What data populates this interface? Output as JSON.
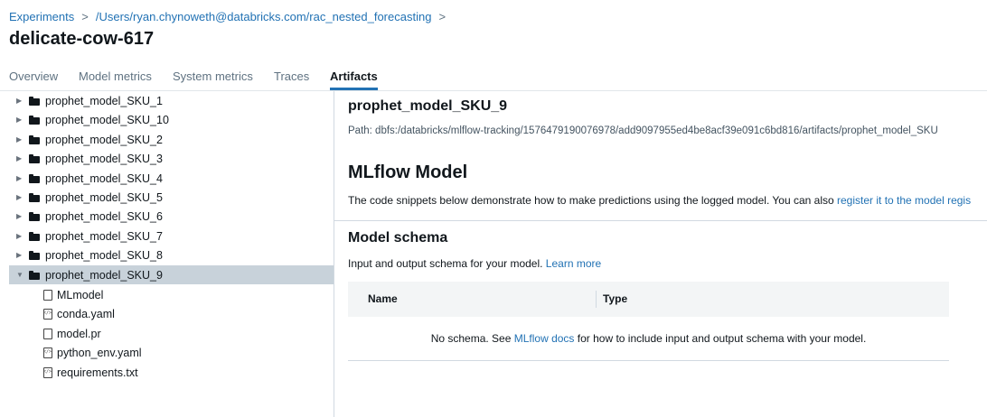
{
  "breadcrumb": {
    "items": [
      "Experiments",
      "/Users/ryan.chynoweth@databricks.com/rac_nested_forecasting"
    ],
    "separator": ">"
  },
  "run": {
    "title": "delicate-cow-617"
  },
  "tabs": [
    {
      "label": "Overview",
      "active": false
    },
    {
      "label": "Model metrics",
      "active": false
    },
    {
      "label": "System metrics",
      "active": false
    },
    {
      "label": "Traces",
      "active": false
    },
    {
      "label": "Artifacts",
      "active": true
    }
  ],
  "tree": {
    "folders": [
      {
        "label": "prophet_model_SKU_1",
        "expanded": false
      },
      {
        "label": "prophet_model_SKU_10",
        "expanded": false
      },
      {
        "label": "prophet_model_SKU_2",
        "expanded": false
      },
      {
        "label": "prophet_model_SKU_3",
        "expanded": false
      },
      {
        "label": "prophet_model_SKU_4",
        "expanded": false
      },
      {
        "label": "prophet_model_SKU_5",
        "expanded": false
      },
      {
        "label": "prophet_model_SKU_6",
        "expanded": false
      },
      {
        "label": "prophet_model_SKU_7",
        "expanded": false
      },
      {
        "label": "prophet_model_SKU_8",
        "expanded": false
      },
      {
        "label": "prophet_model_SKU_9",
        "expanded": true
      }
    ],
    "files": [
      "MLmodel",
      "conda.yaml",
      "model.pr",
      "python_env.yaml",
      "requirements.txt"
    ],
    "caret_collapsed": "▶",
    "caret_expanded": "▼"
  },
  "detail": {
    "artifact_title": "prophet_model_SKU_9",
    "path": "Path: dbfs:/databricks/mlflow-tracking/1576479190076978/add9097955ed4be8acf39e091c6bd816/artifacts/prophet_model_SKU",
    "model_heading": "MLflow Model",
    "description": "The code snippets below demonstrate how to make predictions using the logged model. You can also ",
    "register_link": "register it to the model regis",
    "schema_heading": "Model schema",
    "schema_description": "Input and output schema for your model. ",
    "learn_more": "Learn more",
    "table": {
      "columns": [
        "Name",
        "Type"
      ],
      "empty_prefix": "No schema. See ",
      "empty_link": "MLflow docs",
      "empty_suffix": " for how to include input and output schema with your model."
    }
  },
  "colors": {
    "link": "#2272b4",
    "selected_row": "#c8d2da",
    "active_tab_underline": "#2272b4"
  }
}
